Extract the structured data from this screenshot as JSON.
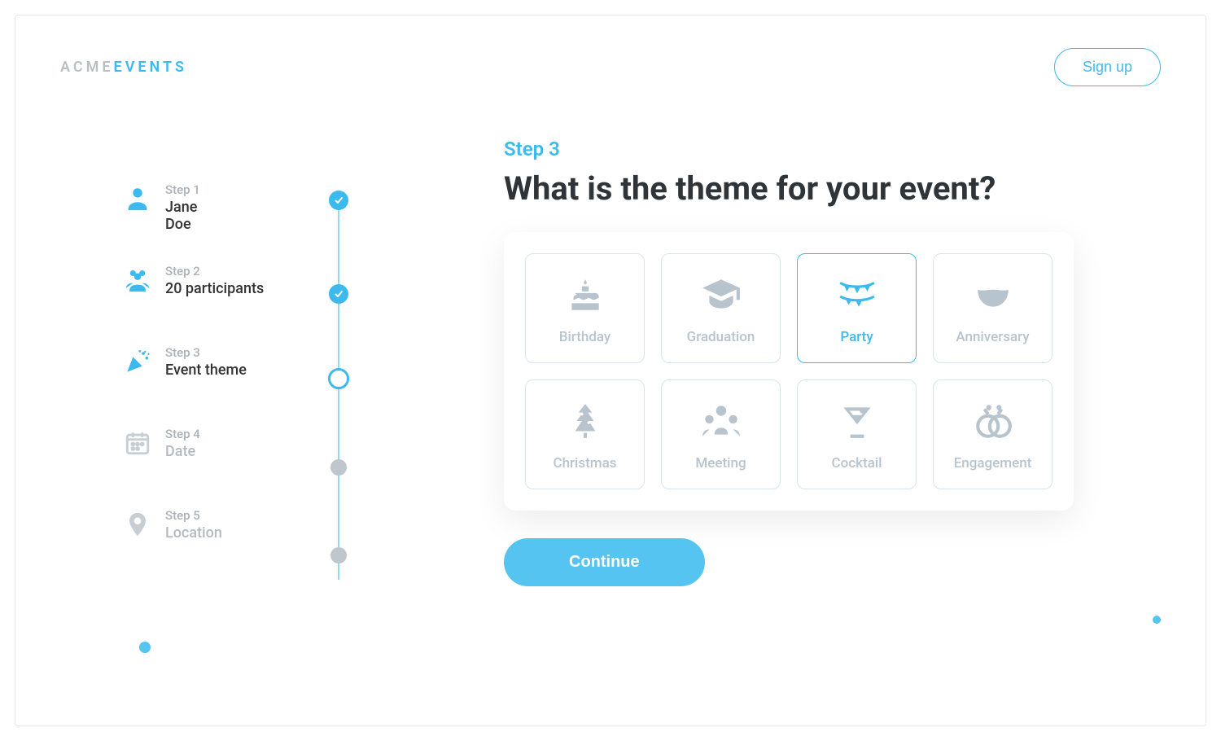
{
  "brand": {
    "part1": "ACME",
    "part2": "EVENTS"
  },
  "header": {
    "signup": "Sign up"
  },
  "timeline": {
    "steps": [
      {
        "label": "Step 1",
        "value": "Jane\nDoe",
        "state": "done"
      },
      {
        "label": "Step 2",
        "value": "20 participants",
        "state": "done"
      },
      {
        "label": "Step 3",
        "value": "Event theme",
        "state": "current"
      },
      {
        "label": "Step 4",
        "value": "Date",
        "state": "future"
      },
      {
        "label": "Step 5",
        "value": "Location",
        "state": "future"
      }
    ]
  },
  "main": {
    "step_indicator": "Step 3",
    "title": "What is the theme for your event?",
    "continue": "Continue",
    "themes": [
      {
        "id": "birthday",
        "label": "Birthday",
        "selected": false
      },
      {
        "id": "graduation",
        "label": "Graduation",
        "selected": false
      },
      {
        "id": "party",
        "label": "Party",
        "selected": true
      },
      {
        "id": "anniversary",
        "label": "Anniversary",
        "selected": false
      },
      {
        "id": "christmas",
        "label": "Christmas",
        "selected": false
      },
      {
        "id": "meeting",
        "label": "Meeting",
        "selected": false
      },
      {
        "id": "cocktail",
        "label": "Cocktail",
        "selected": false
      },
      {
        "id": "engagement",
        "label": "Engagement",
        "selected": false
      }
    ]
  },
  "colors": {
    "accent": "#3cbaf0",
    "muted": "#b8c4cd"
  }
}
